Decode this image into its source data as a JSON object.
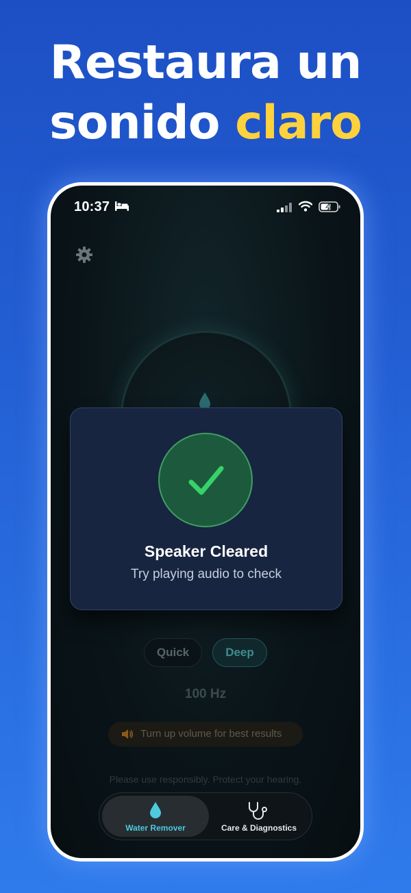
{
  "headline": {
    "line1": "Restaura un",
    "line2_part1": "sonido",
    "line2_accent": "claro"
  },
  "status_bar": {
    "time": "10:37"
  },
  "modal": {
    "title": "Speaker Cleared",
    "subtitle": "Try playing audio to check"
  },
  "modes": [
    {
      "label": "Quick",
      "selected": false
    },
    {
      "label": "Deep",
      "selected": true
    }
  ],
  "frequency": "100 Hz",
  "volume_tip": "Turn up volume for best results",
  "disclaimer": "Please use responsibly. Protect your hearing.",
  "tabs": [
    {
      "label": "Water Remover",
      "icon": "water-drop-icon",
      "active": true
    },
    {
      "label": "Care & Diagnostics",
      "icon": "stethoscope-icon",
      "active": false
    }
  ],
  "colors": {
    "accent_yellow": "#ffd23d",
    "success_green": "#2ecb63",
    "tab_active_teal": "#4ec9de",
    "background_blue": "#2461d6"
  }
}
